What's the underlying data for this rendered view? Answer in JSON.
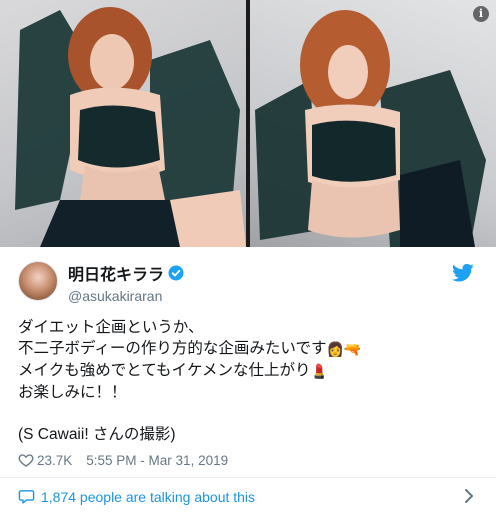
{
  "tweet": {
    "display_name": "明日花キララ",
    "handle": "@asukakiraran",
    "lines": [
      "ダイエット企画というか、",
      "不二子ボディーの作り方的な企画みたいです",
      "メイクも強めでとてもイケメンな仕上がり",
      "お楽しみに！！",
      "(S Cawaii! さんの撮影)"
    ],
    "emoji_line2": [
      "👩",
      "🔫"
    ],
    "emoji_line3": "💄",
    "likes": "23.7K",
    "timestamp": "5:55 PM - Mar 31, 2019",
    "talking": "1,874 people are talking about this"
  },
  "photos": {
    "info_glyph": "i"
  },
  "colors": {
    "twitter_blue": "#1da1f2",
    "link_blue": "#1b95e0",
    "grey": "#657786"
  },
  "icons": [
    "info-icon",
    "verified-icon",
    "twitter-bird-icon",
    "heart-icon",
    "comment-bubble-icon",
    "chevron-right-icon"
  ]
}
